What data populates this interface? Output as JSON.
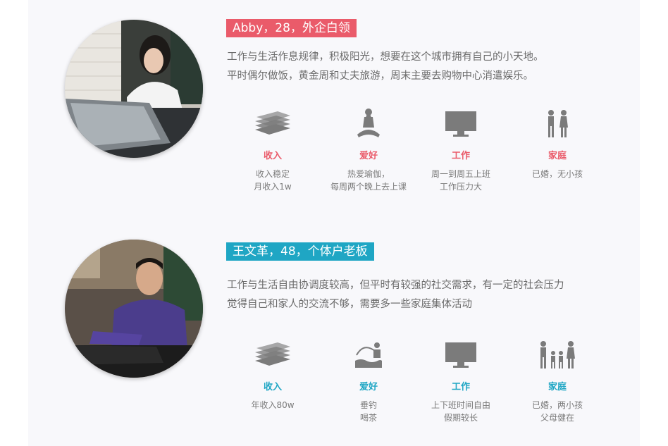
{
  "personas": [
    {
      "tag": "Abby，28，外企白领",
      "description": [
        "工作与生活作息规律，积极阳光，想要在这个城市拥有自己的小天地。",
        "平时偶尔做饭，黄金周和丈夫旅游，周末主要去购物中心消遣娱乐。"
      ],
      "accent": "#ea5b6a",
      "stats": [
        {
          "label": "收入",
          "icon": "money-stack-icon",
          "details": [
            "收入稳定",
            "月收入1w"
          ]
        },
        {
          "label": "爱好",
          "icon": "yoga-icon",
          "details": [
            "热爱瑜伽，",
            "每周两个晚上去上课"
          ]
        },
        {
          "label": "工作",
          "icon": "monitor-icon",
          "details": [
            "周一到周五上班",
            "工作压力大"
          ]
        },
        {
          "label": "家庭",
          "icon": "couple-icon",
          "details": [
            "已婚，无小孩"
          ]
        }
      ]
    },
    {
      "tag": "王文革，48，个体户老板",
      "description": [
        "工作与生活自由协调度较高，但平时有较强的社交需求，有一定的社会压力",
        "觉得自己和家人的交流不够，需要多一些家庭集体活动"
      ],
      "accent": "#1fa6c4",
      "stats": [
        {
          "label": "收入",
          "icon": "money-stack-icon",
          "details": [
            "年收入80w"
          ]
        },
        {
          "label": "爱好",
          "icon": "fishing-icon",
          "details": [
            "垂钓",
            "喝茶"
          ]
        },
        {
          "label": "工作",
          "icon": "monitor-icon",
          "details": [
            "上下班时间自由",
            "假期较长"
          ]
        },
        {
          "label": "家庭",
          "icon": "family-icon",
          "details": [
            "已婚，两小孩",
            "父母健在"
          ]
        }
      ]
    }
  ]
}
